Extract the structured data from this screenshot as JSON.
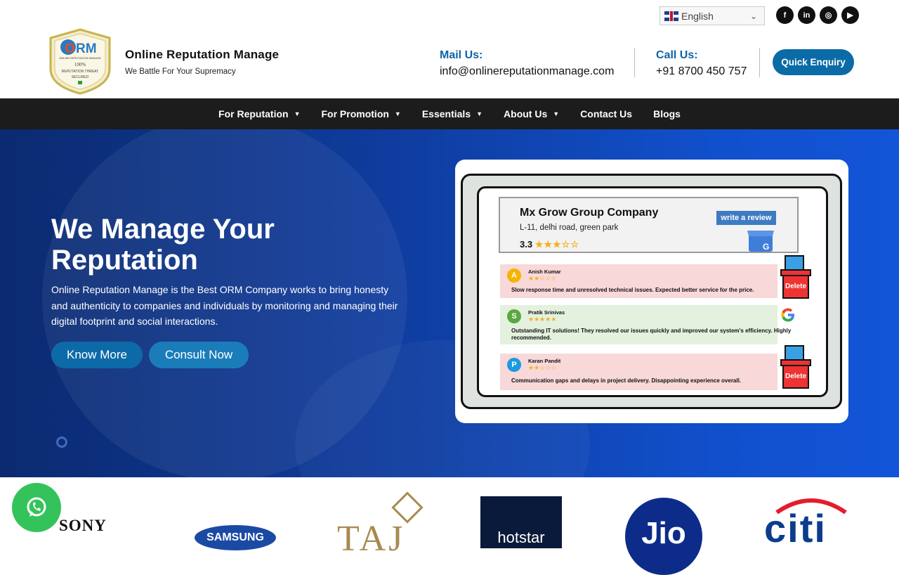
{
  "language": {
    "selected": "English"
  },
  "social": [
    {
      "icon": "facebook-icon",
      "glyph": "f"
    },
    {
      "icon": "linkedin-icon",
      "glyph": "in"
    },
    {
      "icon": "instagram-icon",
      "glyph": "◎"
    },
    {
      "icon": "youtube-icon",
      "glyph": "▶"
    }
  ],
  "brand": {
    "name": "Online Reputation Manage",
    "tagline": "We Battle For Your Supremacy",
    "badge_letters": "ORM",
    "badge_line1": "ONLINE REPUTATION MANAGE",
    "badge_line2": "100%",
    "badge_line3": "REPUTATION THREAT",
    "badge_line4": "SECURED"
  },
  "contact": {
    "mail_label": "Mail Us:",
    "mail_value": "info@onlinereputationmanage.com",
    "call_label": "Call Us:",
    "call_value": "+91 8700 450 757",
    "quick_enquiry": "Quick Enquiry"
  },
  "nav": {
    "items": [
      {
        "label": "For Reputation",
        "dropdown": true
      },
      {
        "label": "For Promotion",
        "dropdown": true
      },
      {
        "label": "Essentials",
        "dropdown": true
      },
      {
        "label": "About Us",
        "dropdown": true
      },
      {
        "label": "Contact Us",
        "dropdown": false
      },
      {
        "label": "Blogs",
        "dropdown": false
      }
    ]
  },
  "hero": {
    "title": "We Manage Your Reputation",
    "description": "Online Reputation Manage is the Best ORM Company works to bring honesty and authenticity to companies and individuals by monitoring and managing their digital footprint and social interactions.",
    "know_more": "Know More",
    "consult_now": "Consult Now"
  },
  "review_card": {
    "business_name": "Mx Grow Group Company",
    "address": "L-11, delhi road, green park",
    "rating": "3.3",
    "write_review": "write a review",
    "delete_label": "Delete",
    "reviews": [
      {
        "initial": "A",
        "name": "Anish Kumar",
        "stars": 2,
        "text": "Slow response time and unresolved technical issues. Expected better service for the price.",
        "color": "#f5b400",
        "bg": "#f8d8d8"
      },
      {
        "initial": "S",
        "name": "Pratik Srinivas",
        "stars": 5,
        "text": "Outstanding IT solutions! They resolved our issues quickly and improved our system's efficiency. Highly recommended.",
        "color": "#5aa83e",
        "bg": "#e4f1de"
      },
      {
        "initial": "P",
        "name": "Karan Pandit",
        "stars": 2,
        "text": "Communication gaps and delays in project delivery. Disappointing experience overall.",
        "color": "#1a9be0",
        "bg": "#f8d8d8"
      }
    ]
  },
  "clients": [
    "SONY",
    "SAMSUNG",
    "TAJ",
    "hotstar",
    "Jio",
    "citi"
  ],
  "colors": {
    "accent": "#0b6ba6",
    "nav_bg": "#1c1c1c",
    "hero_bg": "#0f3da0",
    "whatsapp": "#34c35b"
  }
}
